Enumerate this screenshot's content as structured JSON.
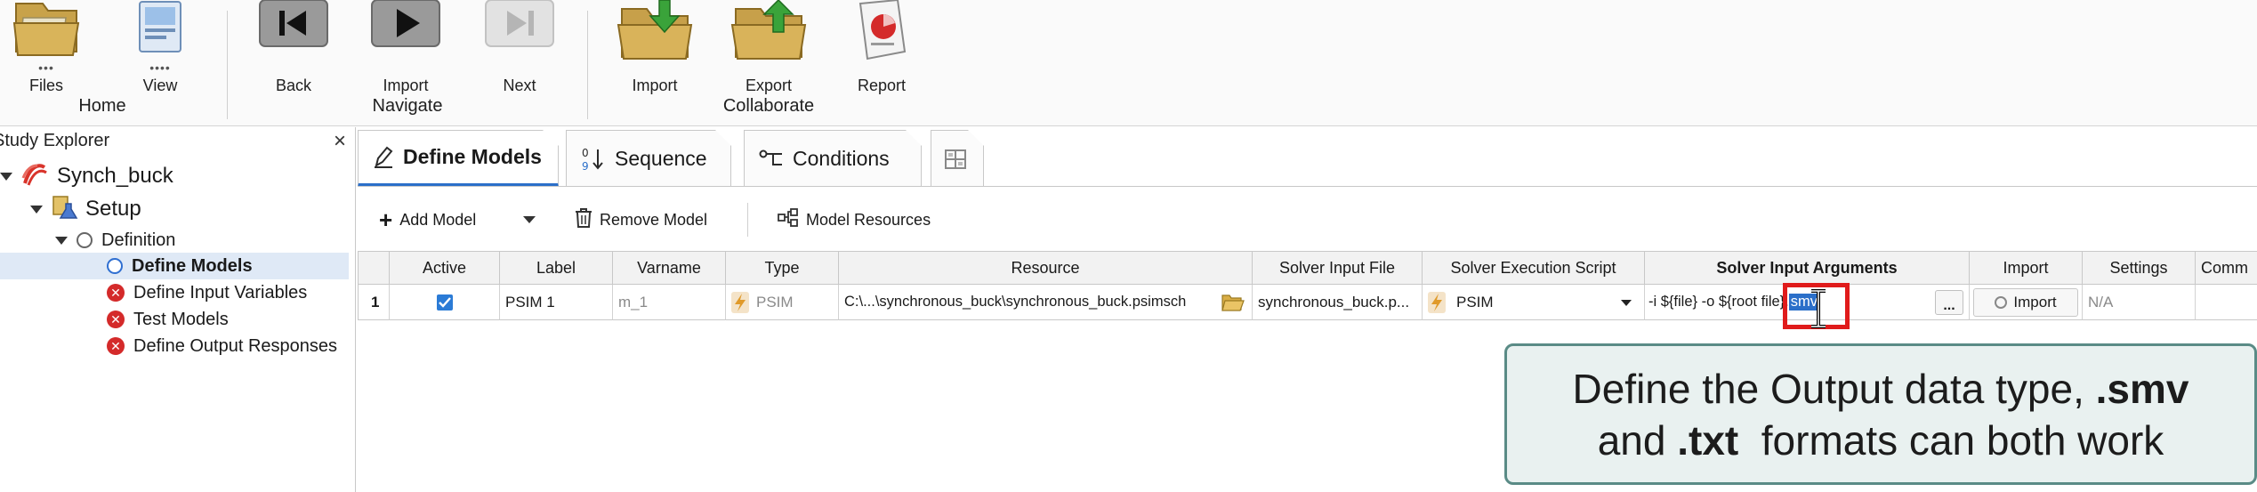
{
  "ribbon": {
    "home": {
      "files": "Files",
      "view": "View",
      "group": "Home"
    },
    "navigate": {
      "back": "Back",
      "import": "Import",
      "next": "Next",
      "group": "Navigate"
    },
    "collaborate": {
      "import": "Import",
      "export": "Export",
      "report": "Report",
      "group": "Collaborate"
    }
  },
  "explorer": {
    "title": "Study Explorer",
    "close": "×",
    "tree": {
      "study": "Synch_buck",
      "setup": "Setup",
      "definition": "Definition",
      "define_models": "Define Models",
      "define_input_variables": "Define Input Variables",
      "test_models": "Test Models",
      "define_output_responses": "Define Output Responses"
    }
  },
  "tabs": {
    "define_models": "Define Models",
    "sequence": "Sequence",
    "conditions": "Conditions"
  },
  "toolbar": {
    "add_model": "Add Model",
    "remove_model": "Remove Model",
    "model_resources": "Model Resources"
  },
  "grid": {
    "headers": {
      "active": "Active",
      "label": "Label",
      "varname": "Varname",
      "type": "Type",
      "resource": "Resource",
      "solver_input_file": "Solver Input File",
      "solver_execution_script": "Solver Execution Script",
      "solver_input_arguments": "Solver Input Arguments",
      "import": "Import",
      "settings": "Settings",
      "comment": "Comm"
    },
    "row": {
      "index": "1",
      "label": "PSIM 1",
      "varname": "m_1",
      "type": "PSIM",
      "resource": "C:\\...\\synchronous_buck\\synchronous_buck.psimsch",
      "solver_input_file": "synchronous_buck.p...",
      "solver_execution_script": "PSIM",
      "solver_input_arguments": "-i ${file} -o ${root file}.",
      "args_selected": "smv",
      "more": "...",
      "import": "Import",
      "settings": "N/A"
    }
  },
  "callout": {
    "line1_pre": "Define the Output data type, ",
    "line1_bold": ".smv",
    "line2_pre": "and ",
    "line2_bold": ".txt",
    "line2_post": "  formats can both work"
  },
  "colors": {
    "accent_blue": "#2b6fc9",
    "error_red": "#d42a2a",
    "highlight_red": "#e01b1b",
    "callout_border": "#5a8b86",
    "callout_bg": "#e9f1f0"
  }
}
